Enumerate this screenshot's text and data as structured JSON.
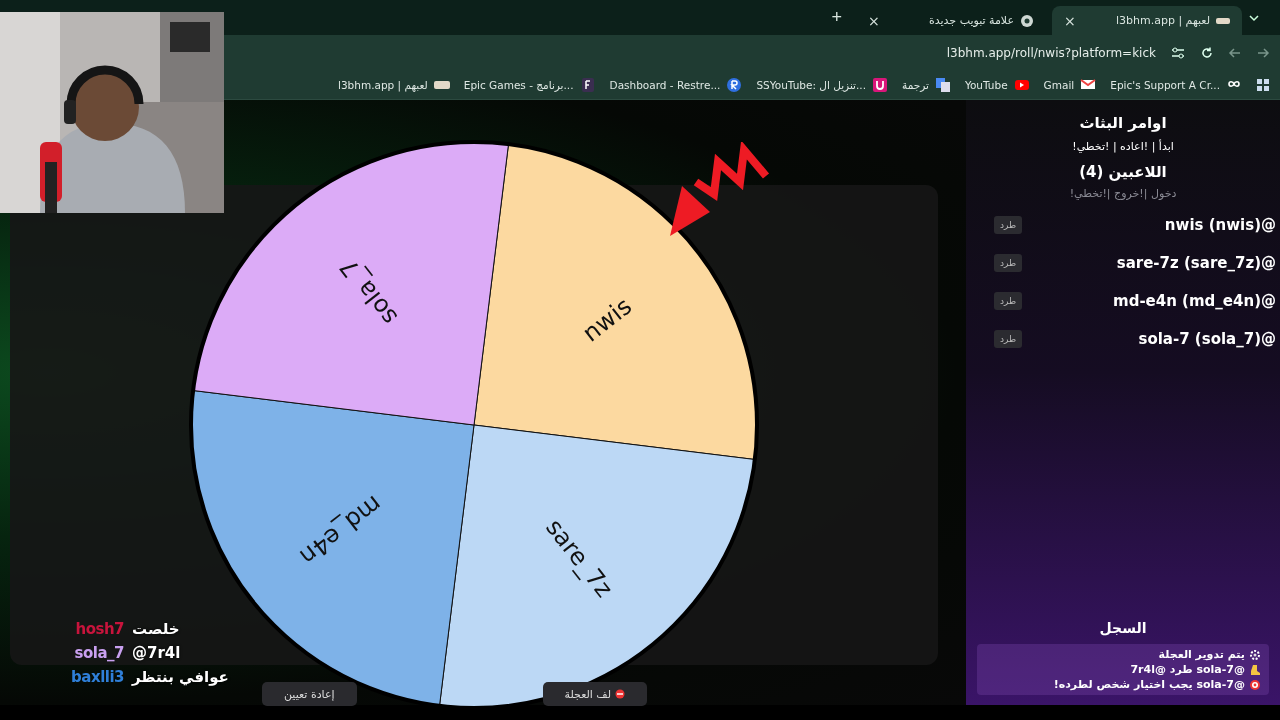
{
  "browser": {
    "tabs": [
      {
        "title": "لعبهم | l3bhm.app",
        "close": "×",
        "selected": true
      },
      {
        "title": "علامة تبويب جديدة",
        "close": "×",
        "selected": false
      }
    ],
    "new_tab": "+",
    "url": "l3bhm.app/roll/nwis?platform=kick",
    "bookmarks": [
      {
        "title": "Epic's Support A Cr...",
        "kind": "infinity"
      },
      {
        "title": "Gmail",
        "kind": "mail"
      },
      {
        "title": "YouTube",
        "kind": "play"
      },
      {
        "title": "ترجمة",
        "kind": "translate"
      },
      {
        "title": "SSYouTube: تنزيل ال...",
        "kind": "pink"
      },
      {
        "title": "Dashboard - Restre...",
        "kind": "circle"
      },
      {
        "title": "Epic Games - برنامج...",
        "kind": "dark"
      },
      {
        "title": "لعبهم | l3bhm.app",
        "kind": "logo"
      }
    ]
  },
  "wheel": {
    "segments": [
      {
        "label": "nwis",
        "color": "#fcd9a0"
      },
      {
        "label": "sare_7z",
        "color": "#bcd8f5"
      },
      {
        "label": "md_e4n",
        "color": "#7eb2e8"
      },
      {
        "label": "sola_7",
        "color": "#dcabf7"
      }
    ]
  },
  "controls": [
    {
      "label": "لف العجلة",
      "kind": "spin"
    },
    {
      "label": "إعادة تعيين",
      "kind": "reset"
    }
  ],
  "sidebar": {
    "commands_title": "اوامر البثاث",
    "commands": "!ابدأ | !اعاده | !تخطي",
    "players_title": "اللاعبين (4)",
    "players_hint": "!دخول |!خروج |!تخطي",
    "players": [
      {
        "name": "nwis (nwis)@",
        "kick": "طرد"
      },
      {
        "name": "sare-7z (sare_7z)@",
        "kick": "طرد"
      },
      {
        "name": "md-e4n (md_e4n)@",
        "kick": "طرد"
      },
      {
        "name": "sola-7 (sola_7)@",
        "kick": "طرد"
      }
    ],
    "log_title": "السجل",
    "log": [
      {
        "kind": "spin",
        "text": "يتم تدوير العجلة"
      },
      {
        "kind": "kick",
        "text": "@sola-7 طرد @7r4l"
      },
      {
        "kind": "target",
        "text": "@sola-7 يجب اختيار شخص لطرده!"
      }
    ]
  },
  "chat": [
    {
      "user": "hosh7",
      "color": "#c8143c",
      "message": "خلصت"
    },
    {
      "user": "sola_7",
      "color": "#c9a0f0",
      "message": "@7r4l"
    },
    {
      "user": "baxlli3",
      "color": "#2f7fd8",
      "message": "عوافي بنتظر"
    }
  ]
}
